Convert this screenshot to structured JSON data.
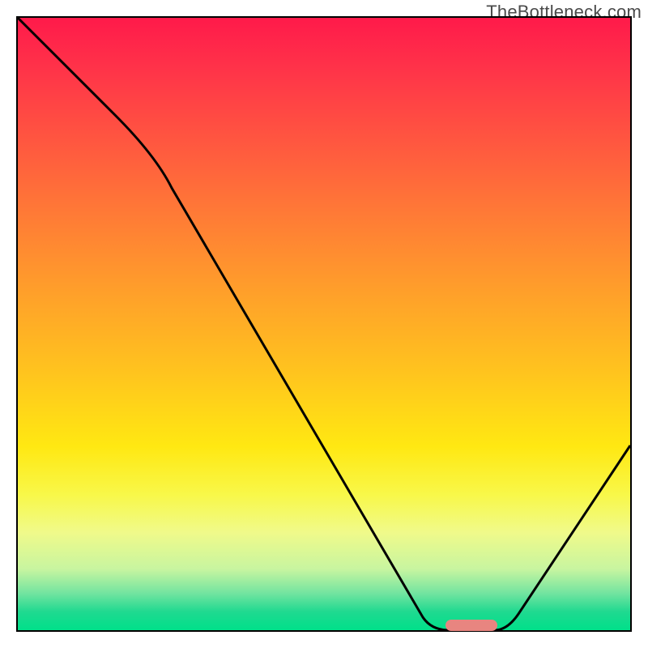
{
  "watermark": "TheBottleneck.com",
  "chart_data": {
    "type": "line",
    "title": "",
    "xlabel": "",
    "ylabel": "",
    "xlim": [
      0,
      1
    ],
    "ylim": [
      0,
      1
    ],
    "series": [
      {
        "name": "curve",
        "x": [
          0.0,
          0.24,
          0.66,
          0.72,
          0.78,
          1.0
        ],
        "y": [
          1.0,
          0.73,
          0.02,
          0.0,
          0.0,
          0.3
        ]
      }
    ],
    "marker": {
      "x_start": 0.7,
      "x_end": 0.78,
      "y": 0.0
    },
    "gradient_stops": [
      {
        "pos": 0.0,
        "color": "#ff1a4a"
      },
      {
        "pos": 0.5,
        "color": "#ffc41e"
      },
      {
        "pos": 0.8,
        "color": "#f8f84a"
      },
      {
        "pos": 1.0,
        "color": "#00e08a"
      }
    ]
  }
}
